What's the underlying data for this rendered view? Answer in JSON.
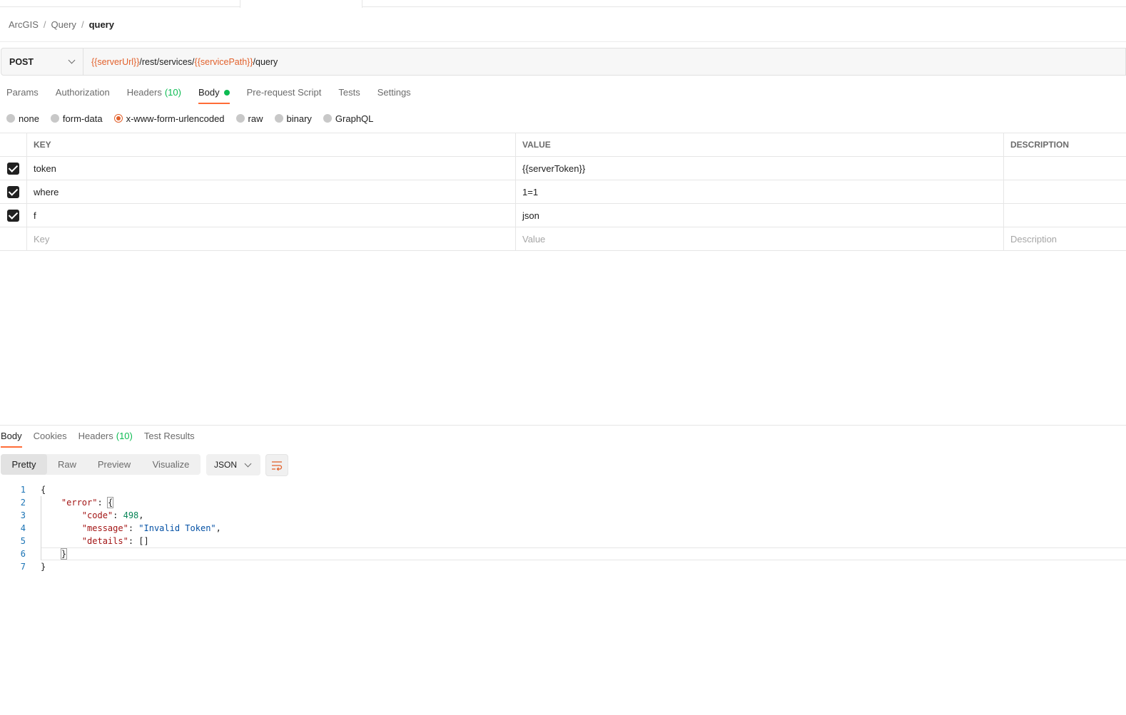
{
  "breadcrumb": [
    "ArcGIS",
    "Query",
    "query"
  ],
  "request": {
    "method": "POST",
    "url_parts": [
      {
        "text": "{{serverUrl}}",
        "var": true
      },
      {
        "text": "/rest/services/",
        "var": false
      },
      {
        "text": "{{servicePath}}",
        "var": true
      },
      {
        "text": "/query",
        "var": false
      }
    ]
  },
  "request_tabs": {
    "params": "Params",
    "authorization": "Authorization",
    "headers": "Headers",
    "headers_count": "(10)",
    "body": "Body",
    "prerequest": "Pre-request Script",
    "tests": "Tests",
    "settings": "Settings"
  },
  "body_types": [
    "none",
    "form-data",
    "x-www-form-urlencoded",
    "raw",
    "binary",
    "GraphQL"
  ],
  "body_type_selected": "x-www-form-urlencoded",
  "table": {
    "headers": {
      "key": "KEY",
      "value": "VALUE",
      "description": "DESCRIPTION"
    },
    "rows": [
      {
        "key": "token",
        "value": "{{serverToken}}",
        "value_var": true,
        "description": ""
      },
      {
        "key": "where",
        "value": "1=1",
        "value_var": false,
        "description": ""
      },
      {
        "key": "f",
        "value": "json",
        "value_var": false,
        "description": ""
      }
    ],
    "placeholders": {
      "key": "Key",
      "value": "Value",
      "description": "Description"
    }
  },
  "response_tabs": {
    "body": "Body",
    "cookies": "Cookies",
    "headers": "Headers",
    "headers_count": "(10)",
    "test_results": "Test Results"
  },
  "view_modes": [
    "Pretty",
    "Raw",
    "Preview",
    "Visualize"
  ],
  "format": "JSON",
  "response_code": {
    "line_numbers": [
      "1",
      "2",
      "3",
      "4",
      "5",
      "6",
      "7"
    ],
    "error_key": "\"error\"",
    "code_key": "\"code\"",
    "code_value": "498",
    "message_key": "\"message\"",
    "message_value": "\"Invalid Token\"",
    "details_key": "\"details\"",
    "details_value": "[]"
  },
  "colors": {
    "accent": "#ff6c37",
    "variable": "#e2612c",
    "count_green": "#0cbb52"
  },
  "icons": {
    "method_dropdown": "chevron-down-icon",
    "wrap": "wrap-lines-icon"
  }
}
